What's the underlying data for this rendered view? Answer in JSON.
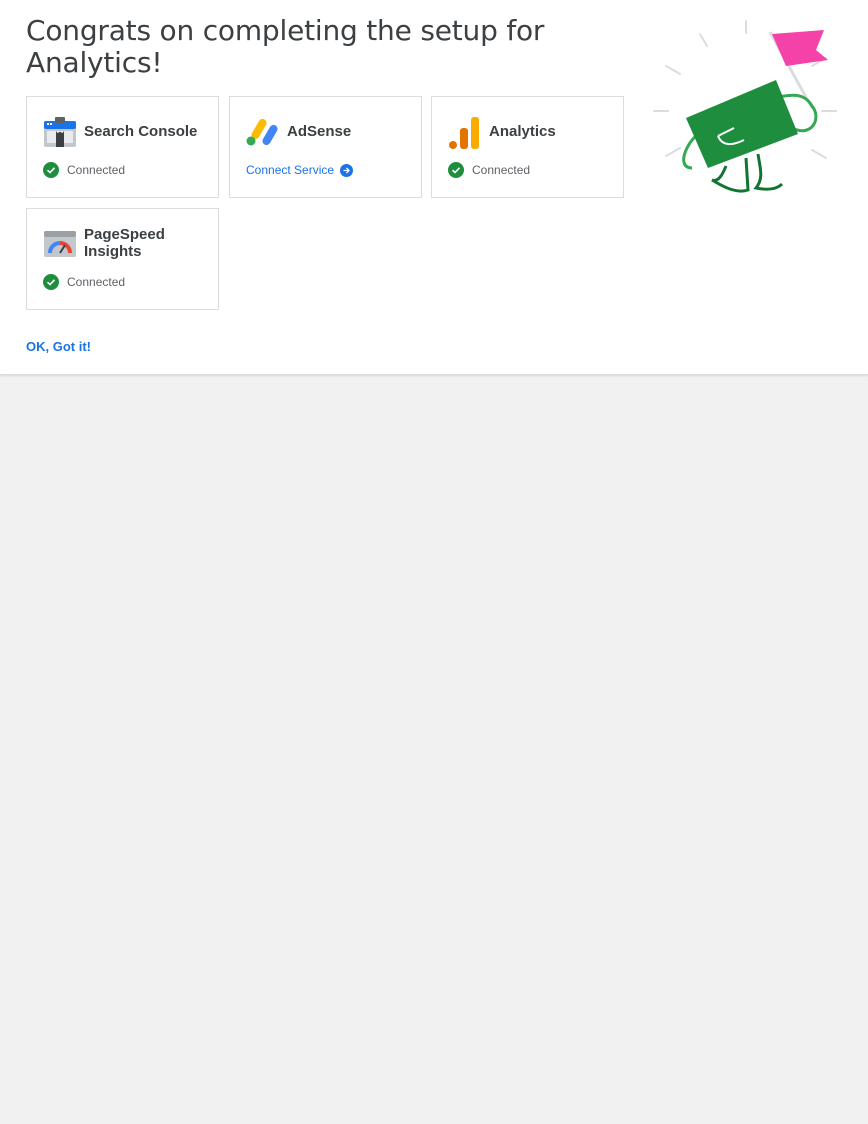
{
  "dialog": {
    "title": "Congrats on completing the setup for Analytics!",
    "ok_label": "OK, Got it!"
  },
  "services": [
    {
      "name": "Search Console",
      "status": "Connected",
      "icon": "search-console-icon"
    },
    {
      "name": "AdSense",
      "action": "Connect Service",
      "icon": "adsense-icon"
    },
    {
      "name": "Analytics",
      "status": "Connected",
      "icon": "analytics-icon"
    },
    {
      "name": "PageSpeed Insights",
      "status": "Connected",
      "icon": "pagespeed-icon"
    }
  ],
  "colors": {
    "accent": "#1a73e8",
    "connected": "#1e8e3e",
    "flag": "#f442a8",
    "celebration_green": "#1e8e3e",
    "background": "#f1f1f1"
  }
}
